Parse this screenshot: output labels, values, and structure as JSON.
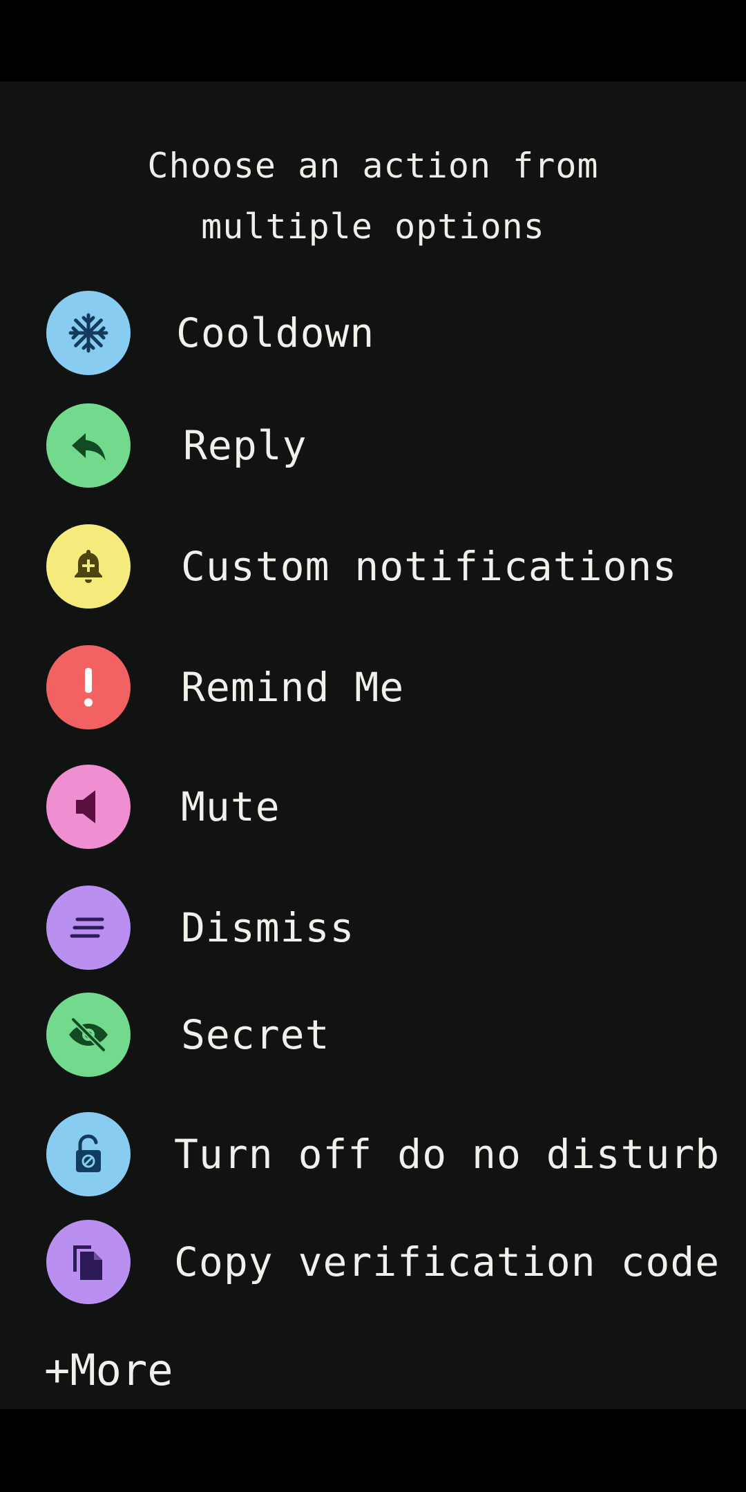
{
  "header": {
    "line1": "Choose an action from",
    "line2": "multiple options"
  },
  "actions": [
    {
      "label": "Cooldown",
      "icon": "snowflake-icon",
      "bg": "#88ccf1",
      "fg": "#123c5e"
    },
    {
      "label": "Reply",
      "icon": "reply-arrow-icon",
      "bg": "#73d98c",
      "fg": "#134a24"
    },
    {
      "label": "Custom notifications",
      "icon": "bell-plus-icon",
      "bg": "#f4eb7c",
      "fg": "#4d4414"
    },
    {
      "label": "Remind Me",
      "icon": "exclamation-icon",
      "bg": "#f26262",
      "fg": "#ffffff"
    },
    {
      "label": "Mute",
      "icon": "speaker-icon",
      "bg": "#f08ed2",
      "fg": "#5a0f3e"
    },
    {
      "label": "Dismiss",
      "icon": "lines-icon",
      "bg": "#b990f0",
      "fg": "#2d1a58"
    },
    {
      "label": "Secret",
      "icon": "eye-off-icon",
      "bg": "#73d98c",
      "fg": "#134a24"
    },
    {
      "label": "Turn off do no disturb",
      "icon": "unlock-icon",
      "bg": "#88ccf1",
      "fg": "#123c5e"
    },
    {
      "label": "Copy verification code",
      "icon": "copy-icon",
      "bg": "#b990f0",
      "fg": "#2d1a58"
    }
  ],
  "more_label": "+More"
}
